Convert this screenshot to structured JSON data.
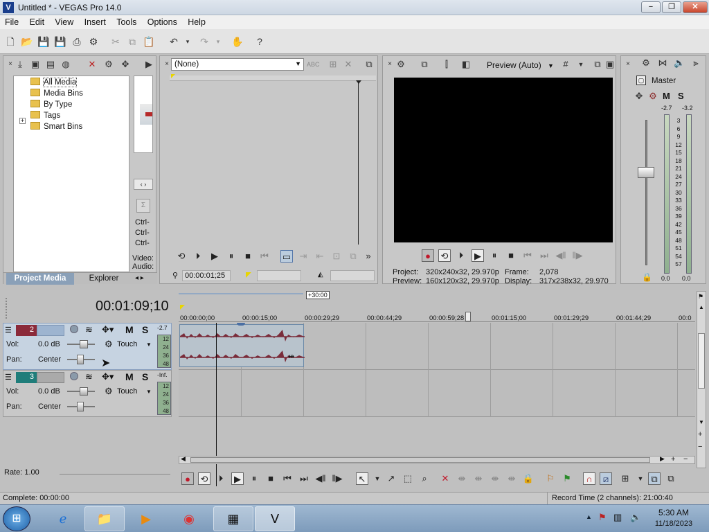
{
  "window": {
    "title": "Untitled * - VEGAS Pro 14.0",
    "minimize": "−",
    "restore": "❐",
    "close": "✕"
  },
  "menu": [
    "File",
    "Edit",
    "View",
    "Insert",
    "Tools",
    "Options",
    "Help"
  ],
  "project_media": {
    "tree": [
      "All Media",
      "Media Bins",
      "By Type",
      "Tags",
      "Smart Bins"
    ],
    "expander": "+",
    "info_lines": [
      "Ctrl-",
      "Ctrl-",
      "Ctrl-"
    ],
    "video_label": "Video:",
    "audio_label": "Audio:",
    "tabs": [
      "Project Media",
      "Explorer"
    ]
  },
  "trimmer": {
    "dropdown_value": "(None)",
    "timecode": "00:00:01;25"
  },
  "preview": {
    "quality": "Preview (Auto)",
    "project_label": "Project:",
    "project_value": "320x240x32, 29.970p",
    "frame_label": "Frame:",
    "frame_value": "2,078",
    "preview_label": "Preview:",
    "preview_value": "160x120x32, 29.970p",
    "display_label": "Display:",
    "display_value": "317x238x32, 29.970"
  },
  "mixer": {
    "master_label": "Master",
    "m": "M",
    "s": "S",
    "peak_left": "-2.7",
    "peak_right": "-3.2",
    "scale": [
      "3",
      "6",
      "9",
      "12",
      "15",
      "18",
      "21",
      "24",
      "27",
      "30",
      "33",
      "36",
      "39",
      "42",
      "45",
      "48",
      "51",
      "54",
      "57"
    ],
    "bottom_left": "0.0",
    "bottom_right": "0.0"
  },
  "timeline": {
    "current_time": "00:01:09;10",
    "zoom_tag": "+30:00",
    "ruler": [
      "00:00:00;00",
      "00:00:15;00",
      "00:00:29;29",
      "00:00:44;29",
      "00:00:59;28",
      "00:01:15;00",
      "00:01:29;29",
      "00:01:44;29",
      "00:0"
    ],
    "tracks": [
      {
        "number": "2",
        "vol_label": "Vol:",
        "vol_value": "0.0 dB",
        "pan_label": "Pan:",
        "pan_value": "Center",
        "mode": "Touch",
        "m": "M",
        "s": "S",
        "peak": "-2.7",
        "meter": [
          "12",
          "24",
          "36",
          "48"
        ]
      },
      {
        "number": "3",
        "vol_label": "Vol:",
        "vol_value": "0.0 dB",
        "pan_label": "Pan:",
        "pan_value": "Center",
        "mode": "Touch",
        "m": "M",
        "s": "S",
        "peak": "-Inf.",
        "meter": [
          "12",
          "24",
          "36",
          "48"
        ]
      }
    ],
    "rate": "Rate: 1.00"
  },
  "status": {
    "complete": "Complete: 00:00:00",
    "record_time": "Record Time (2 channels): 21:00:40"
  },
  "taskbar": {
    "time": "5:30 AM",
    "date": "11/18/2023"
  }
}
